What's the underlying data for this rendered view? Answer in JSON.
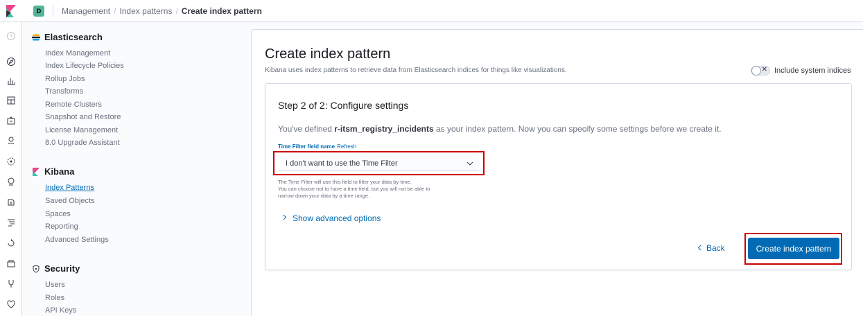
{
  "header": {
    "space_initial": "D",
    "breadcrumbs": [
      "Management",
      "Index patterns",
      "Create index pattern"
    ]
  },
  "nav_icons": [
    "clock-icon",
    "compass-icon",
    "visualize-icon",
    "dashboard-icon",
    "canvas-icon",
    "maps-icon",
    "ml-icon",
    "metrics-icon",
    "logs-icon",
    "apm-icon",
    "uptime-icon",
    "dev-tools-icon",
    "monitoring-icon",
    "management-icon"
  ],
  "sidebar": {
    "elasticsearch": {
      "title": "Elasticsearch",
      "items": [
        "Index Management",
        "Index Lifecycle Policies",
        "Rollup Jobs",
        "Transforms",
        "Remote Clusters",
        "Snapshot and Restore",
        "License Management",
        "8.0 Upgrade Assistant"
      ]
    },
    "kibana": {
      "title": "Kibana",
      "items": [
        "Index Patterns",
        "Saved Objects",
        "Spaces",
        "Reporting",
        "Advanced Settings"
      ],
      "active": "Index Patterns"
    },
    "security": {
      "title": "Security",
      "items": [
        "Users",
        "Roles",
        "API Keys"
      ]
    }
  },
  "main": {
    "title": "Create index pattern",
    "description": "Kibana uses index patterns to retrieve data from Elasticsearch indices for things like visualizations.",
    "toggle_label": "Include system indices",
    "toggle_on": false
  },
  "step": {
    "title": "Step 2 of 2: Configure settings",
    "desc_prefix": "You've defined ",
    "pattern_name": "r-itsm_registry_incidents",
    "desc_suffix": " as your index pattern. Now you can specify some settings before we create it.",
    "field_label": "Time Filter field name",
    "refresh_label": "Refresh",
    "select_value": "I don't want to use the Time Filter",
    "help_lines": [
      "The Time Filter will use this field to filter your data by time.",
      "You can choose not to have a time field, but you will not be able to",
      "narrow down your data by a time range."
    ],
    "advanced_label": "Show advanced options",
    "back_label": "Back",
    "create_label": "Create index pattern"
  },
  "colors": {
    "accent": "#006bb4",
    "highlight_outline": "#cc0000",
    "space_badge": "#54b399"
  }
}
